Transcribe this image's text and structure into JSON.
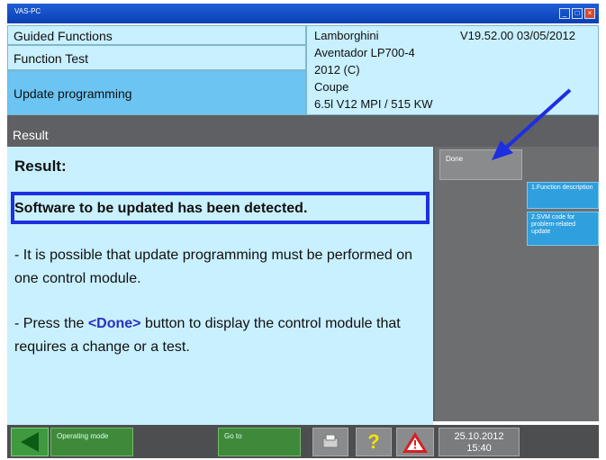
{
  "window": {
    "title": "VAS-PC"
  },
  "header": {
    "row1": "Guided Functions",
    "row2": "Function Test",
    "row3": "Update programming"
  },
  "vehicle": {
    "make": "Lamborghini",
    "version": "V19.52.00 03/05/2012",
    "model": "Aventador LP700-4",
    "year": "2012 (C)",
    "body": "Coupe",
    "engine": "6.5l V12 MPI / 515 KW"
  },
  "result_bar": {
    "label": "Result"
  },
  "content": {
    "result_label": "Result:",
    "detected_text": "Software to be updated has been detected.",
    "p1": "- It is possible that update programming must be performed on one control module.",
    "p2_prefix": "- Press the ",
    "p2_button": "<Done>",
    "p2_suffix": " button to display the control module that requires a change or a test."
  },
  "right_panel": {
    "done_label": "Done",
    "side1_label": "1.Function description",
    "side2_label": "2.SVM code for problem-related update"
  },
  "bottom_bar": {
    "operating_mode_label": "Operating mode",
    "goto_label": "Go to",
    "help_symbol": "?",
    "date": "25.10.2012",
    "time": "15:40"
  },
  "colors": {
    "header_bg": "#c8f0ff",
    "selected_row_bg": "#6cc4f2",
    "highlight_box": "#1d2fe0",
    "panel_dark": "#5f6063"
  },
  "icons": [
    "back-arrow-icon",
    "printer-icon",
    "help-icon",
    "warning-icon",
    "annotation-arrow"
  ]
}
